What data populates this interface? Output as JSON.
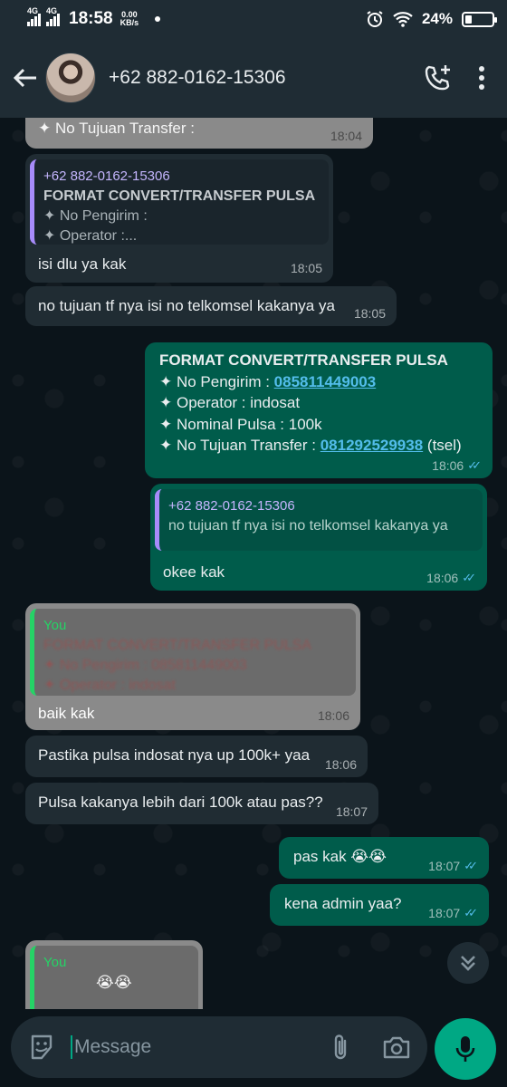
{
  "status_bar": {
    "net1": "4G",
    "net2": "4G",
    "time": "18:58",
    "speed_value": "0.00",
    "speed_unit": "KB/s",
    "battery": "24%",
    "battery_level": 0.24
  },
  "header": {
    "contact": "+62 882-0162-15306",
    "icons": [
      "back-arrow-icon",
      "add-call-icon",
      "more-vert-icon"
    ]
  },
  "messages": [
    {
      "dir": "in",
      "text": "✦ No Tujuan Transfer :",
      "time": "18:04"
    },
    {
      "dir": "in",
      "quote_name": "+62 882-0162-15306",
      "quote_title": "FORMAT CONVERT/TRANSFER PULSA",
      "quote_l1": "✦ No Pengirim :",
      "quote_l2": "✦ Operator :...",
      "text": "isi dlu ya kak",
      "time": "18:05"
    },
    {
      "dir": "in",
      "text": "no tujuan tf nya isi no telkomsel kakanya ya",
      "time": "18:05"
    },
    {
      "dir": "out",
      "l1": "FORMAT CONVERT/TRANSFER PULSA",
      "l2_prefix": "✦ No Pengirim : ",
      "l2_link": "085811449003",
      "l3": "✦ Operator : indosat",
      "l4": "✦ Nominal Pulsa : 100k",
      "l5_prefix": "✦ No Tujuan Transfer : ",
      "l5_link": "081292529938",
      "l5_suffix": " (tsel)",
      "time": "18:06"
    },
    {
      "dir": "out",
      "quote_name": "+62 882-0162-15306",
      "quote_text": "no tujuan tf nya isi no telkomsel kakanya ya",
      "text": "okee kak",
      "time": "18:06"
    },
    {
      "dir": "in",
      "quote_name": "You",
      "quote_title": "FORMAT CONVERT/TRANSFER PULSA",
      "quote_l1": "✦ No Pengirim : 085811449003",
      "quote_l2": "✦ Operator : indosat",
      "text": "baik kak",
      "time": "18:06"
    },
    {
      "dir": "in",
      "text": "Pastika pulsa indosat nya up 100k+ yaa",
      "time": "18:06"
    },
    {
      "dir": "in",
      "text": "Pulsa kakanya lebih dari 100k atau pas??",
      "time": "18:07"
    },
    {
      "dir": "out",
      "text": "pas kak 😭😭",
      "time": "18:07"
    },
    {
      "dir": "out",
      "text": "kena admin yaa?",
      "time": "18:07"
    },
    {
      "dir": "in",
      "quote_name": "You",
      "quote_text": "😭😭"
    }
  ],
  "composer": {
    "placeholder": "Message",
    "icons": [
      "emoji-icon",
      "attach-icon",
      "camera-icon",
      "mic-icon"
    ]
  },
  "colors": {
    "background": "#0b141a",
    "incoming": "#202c33",
    "outgoing": "#005c4b",
    "accent": "#00a884",
    "read_ticks": "#53bdeb"
  }
}
